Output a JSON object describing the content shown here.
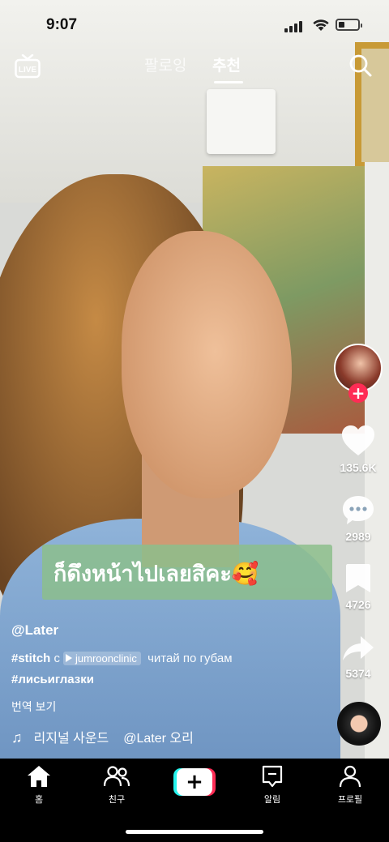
{
  "status_bar": {
    "time": "9:07",
    "battery_level": 0.3
  },
  "top_bar": {
    "live_label": "LIVE",
    "tabs": [
      {
        "label": "팔로잉",
        "active": false
      },
      {
        "label": "추천",
        "active": true
      }
    ]
  },
  "video": {
    "caption_sticker": "ก็ดึงหน้าไปเลยสิคะ🥰"
  },
  "actions": {
    "likes": "135.6K",
    "comments": "2989",
    "saves": "4726",
    "shares": "5374"
  },
  "post": {
    "username": "@Later",
    "stitch_tag": "#stitch",
    "stitch_with": "с",
    "stitch_source": "jumroonclinic",
    "desc_line1_rest": "читай по губам",
    "hashtag2": "#лисьиглазки",
    "translate": "번역 보기",
    "sound": "리지널 사운드",
    "sound_author": "@Later 오리"
  },
  "nav": {
    "items": [
      {
        "label": "홈",
        "icon": "home-icon"
      },
      {
        "label": "친구",
        "icon": "friends-icon"
      },
      {
        "label": "",
        "icon": "plus-icon"
      },
      {
        "label": "알림",
        "icon": "inbox-icon"
      },
      {
        "label": "프로필",
        "icon": "profile-icon"
      }
    ]
  },
  "colors": {
    "accent": "#fe2c55",
    "cyan": "#25f4ee"
  }
}
